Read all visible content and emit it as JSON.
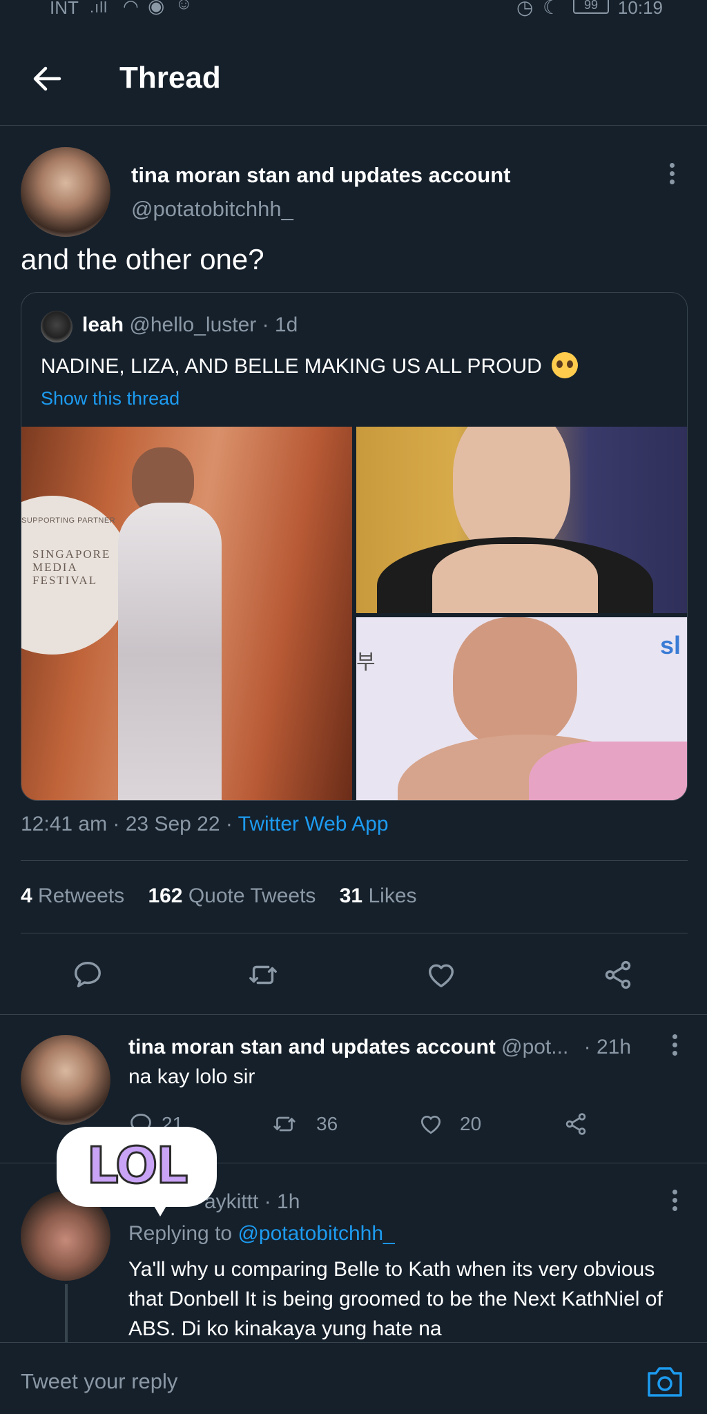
{
  "status_bar": {
    "left": "INT",
    "time": "10:19",
    "battery": "99"
  },
  "header": {
    "title": "Thread"
  },
  "tweet": {
    "author_name": "tina moran stan and updates account",
    "author_handle": "@potatobitchhh_",
    "text": "and the other one?",
    "quote": {
      "name": "leah",
      "handle": "@hello_luster",
      "age": "· 1d",
      "text": "NADINE, LIZA, AND BELLE MAKING US ALL PROUD",
      "show_thread": "Show this thread",
      "image_text": {
        "sponsor": "SUPPORTING PARTNER",
        "event_line1": "SINGAPORE",
        "event_line2": "MEDIA",
        "event_line3": "FESTIVAL",
        "sign_korean": "부",
        "sign_partial": "sl"
      }
    },
    "timestamp": "12:41 am · 23 Sep 22 · ",
    "source": "Twitter Web App",
    "stats": {
      "retweets_count": "4",
      "retweets_label": "Retweets",
      "quotes_count": "162",
      "quotes_label": "Quote Tweets",
      "likes_count": "31",
      "likes_label": "Likes"
    }
  },
  "replies": [
    {
      "author_name": "tina moran stan and updates account",
      "author_handle": "@pot...",
      "age": "· 21h",
      "text": "na kay lolo sir",
      "reply_count": "21",
      "retweet_count": "36",
      "like_count": "20"
    },
    {
      "author_handle_partial": "aykittt",
      "age": "· 1h",
      "replying_prefix": "Replying to ",
      "replying_to": "@potatobitchhh_",
      "text": "Ya'll why u comparing Belle to Kath when its very obvious that Donbell It is being groomed to be the Next KathNiel of ABS. Di ko kinakaya yung hate na"
    }
  ],
  "sticker": {
    "text": "LOL"
  },
  "reply_bar": {
    "placeholder": "Tweet your reply"
  },
  "colors": {
    "background": "#15202b",
    "accent": "#1d9bf0",
    "muted": "#8b98a5",
    "divider": "#38444d"
  }
}
